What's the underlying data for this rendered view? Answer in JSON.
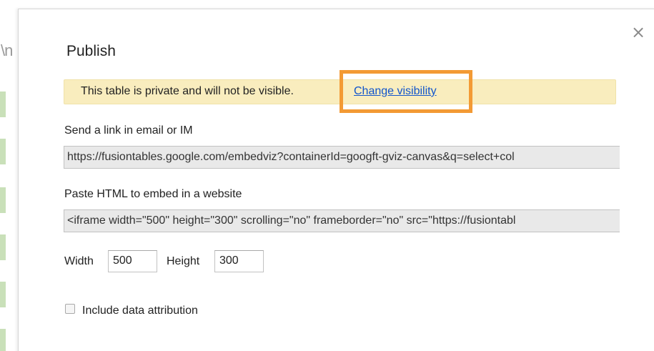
{
  "background": {
    "partial_text": "\\n"
  },
  "dialog": {
    "title": "Publish",
    "close_symbol": "×",
    "notice": {
      "text": "This table is private and will not be visible.",
      "link": "Change visibility"
    },
    "email_section": {
      "label": "Send a link in email or IM",
      "value": "https://fusiontables.google.com/embedviz?containerId=googft-gviz-canvas&q=select+col"
    },
    "embed_section": {
      "label": "Paste HTML to embed in a website",
      "value": "<iframe width=\"500\" height=\"300\" scrolling=\"no\" frameborder=\"no\" src=\"https://fusiontabl"
    },
    "size": {
      "width_label": "Width",
      "width_value": "500",
      "height_label": "Height",
      "height_value": "300"
    },
    "attribution": {
      "label": "Include data attribution",
      "checked": false
    }
  },
  "colors": {
    "notice_bg": "#f9edbe",
    "link": "#1155cc",
    "highlight": "#f39a34",
    "field_bg": "#e9e9e9",
    "bg_bars": "#c9e0b9"
  }
}
